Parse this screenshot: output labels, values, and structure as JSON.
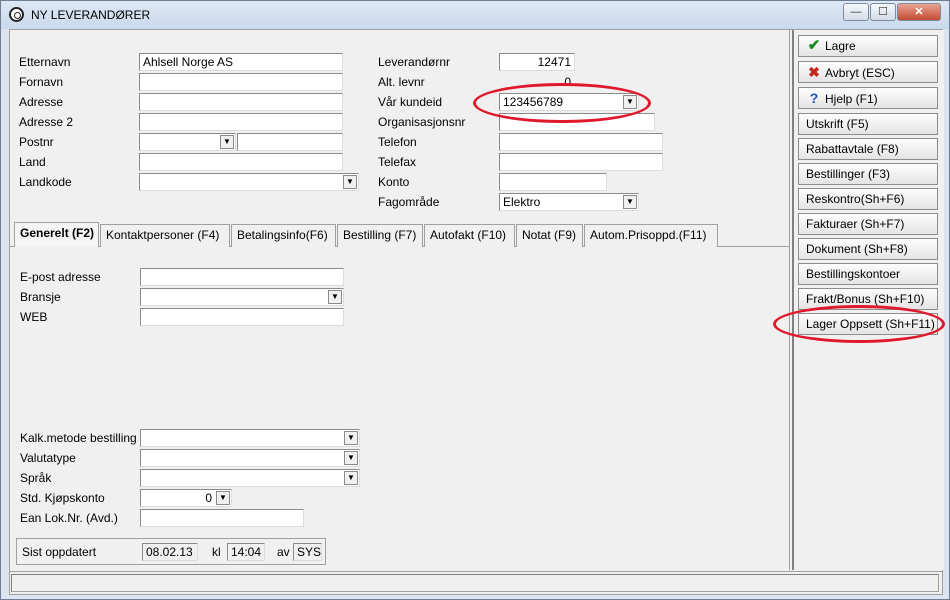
{
  "window": {
    "title": "NY LEVERANDØRER",
    "minimize": "—",
    "maximize": "☐",
    "close": "✕"
  },
  "form": {
    "etternavn": {
      "label": "Etternavn",
      "value": "Ahlsell Norge AS"
    },
    "fornavn": {
      "label": "Fornavn",
      "value": ""
    },
    "adresse": {
      "label": "Adresse",
      "value": ""
    },
    "adresse2": {
      "label": "Adresse 2",
      "value": ""
    },
    "postnr": {
      "label": "Postnr",
      "value": "",
      "sted": ""
    },
    "land": {
      "label": "Land",
      "value": ""
    },
    "landkode": {
      "label": "Landkode",
      "value": ""
    },
    "leverandornr": {
      "label": "Leverandørnr",
      "value": "12471"
    },
    "alt_levnr": {
      "label": "Alt. levnr",
      "value": "0"
    },
    "var_kundeid": {
      "label": "Vår kundeid",
      "value": "123456789"
    },
    "organisasjonsnr": {
      "label": "Organisasjonsnr",
      "value": ""
    },
    "telefon": {
      "label": "Telefon",
      "value": ""
    },
    "telefax": {
      "label": "Telefax",
      "value": ""
    },
    "konto": {
      "label": "Konto",
      "value": ""
    },
    "fagomrade": {
      "label": "Fagområde",
      "value": "Elektro"
    }
  },
  "tabs": [
    {
      "label": "Generelt (F2)",
      "active": true
    },
    {
      "label": "Kontaktpersoner (F4)"
    },
    {
      "label": "Betalingsinfo(F6)"
    },
    {
      "label": "Bestilling (F7)"
    },
    {
      "label": "Autofakt (F10)"
    },
    {
      "label": "Notat (F9)"
    },
    {
      "label": "Autom.Prisoppd.(F11)"
    }
  ],
  "general": {
    "epost": {
      "label": "E-post adresse",
      "value": ""
    },
    "bransje": {
      "label": "Bransje",
      "value": ""
    },
    "web": {
      "label": "WEB",
      "value": ""
    },
    "kalk": {
      "label": "Kalk.metode bestilling",
      "value": ""
    },
    "valutatype": {
      "label": "Valutatype",
      "value": ""
    },
    "sprak": {
      "label": "Språk",
      "value": ""
    },
    "kjopskonto": {
      "label": "Std. Kjøpskonto",
      "value": "0"
    },
    "ean": {
      "label": "Ean Lok.Nr. (Avd.)",
      "value": ""
    }
  },
  "footer": {
    "sist_label": "Sist oppdatert",
    "date": "08.02.13",
    "kl_label": "kl",
    "time": "14:04",
    "av_label": "av",
    "user": "SYS"
  },
  "sidebar": {
    "buttons": [
      {
        "label": "Lagre",
        "icon": "check-icon"
      },
      {
        "label": "Avbryt (ESC)",
        "icon": "cross-icon"
      },
      {
        "label": "Hjelp (F1)",
        "icon": "question-icon"
      },
      {
        "label": "Utskrift (F5)"
      },
      {
        "label": "Rabattavtale (F8)"
      },
      {
        "label": "Bestillinger (F3)"
      },
      {
        "label": "Reskontro(Sh+F6)"
      },
      {
        "label": "Fakturaer (Sh+F7)"
      },
      {
        "label": "Dokument (Sh+F8)"
      },
      {
        "label": "Bestillingskontoer"
      },
      {
        "label": "Frakt/Bonus (Sh+F10)"
      },
      {
        "label": "Lager Oppsett (Sh+F11)"
      }
    ]
  },
  "annotation_color": "#e0182c"
}
